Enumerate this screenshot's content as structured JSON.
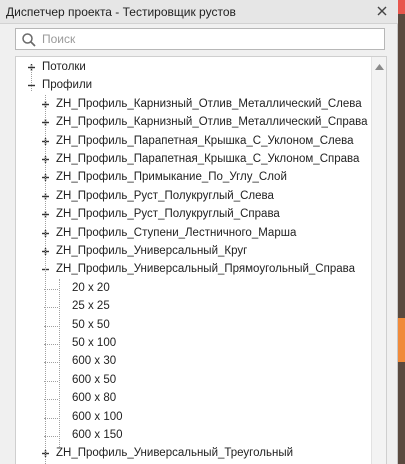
{
  "panel": {
    "title": "Диспетчер проекта - Тестировщик рустов"
  },
  "search": {
    "placeholder": "Поиск",
    "value": ""
  },
  "tree": [
    {
      "label": "Потолки",
      "level": 0,
      "state": "collapsed"
    },
    {
      "label": "Профили",
      "level": 0,
      "state": "expanded"
    },
    {
      "label": "ZH_Профиль_Карнизный_Отлив_Металлический_Слева",
      "level": 1,
      "state": "collapsed"
    },
    {
      "label": "ZH_Профиль_Карнизный_Отлив_Металлический_Справа",
      "level": 1,
      "state": "collapsed"
    },
    {
      "label": "ZH_Профиль_Парапетная_Крышка_С_Уклоном_Слева",
      "level": 1,
      "state": "collapsed"
    },
    {
      "label": "ZH_Профиль_Парапетная_Крышка_С_Уклоном_Справа",
      "level": 1,
      "state": "collapsed"
    },
    {
      "label": "ZH_Профиль_Примыкание_По_Углу_Слой",
      "level": 1,
      "state": "collapsed"
    },
    {
      "label": "ZH_Профиль_Руст_Полукруглый_Слева",
      "level": 1,
      "state": "collapsed"
    },
    {
      "label": "ZH_Профиль_Руст_Полукруглый_Справа",
      "level": 1,
      "state": "collapsed"
    },
    {
      "label": "ZH_Профиль_Ступени_Лестничного_Марша",
      "level": 1,
      "state": "collapsed"
    },
    {
      "label": "ZH_Профиль_Универсальный_Круг",
      "level": 1,
      "state": "collapsed"
    },
    {
      "label": "ZH_Профиль_Универсальный_Прямоугольный_Справа",
      "level": 1,
      "state": "expanded"
    },
    {
      "label": "20 x 20",
      "level": 2,
      "state": "leaf"
    },
    {
      "label": "25 x 25",
      "level": 2,
      "state": "leaf"
    },
    {
      "label": "50 x 50",
      "level": 2,
      "state": "leaf"
    },
    {
      "label": "50 x 100",
      "level": 2,
      "state": "leaf"
    },
    {
      "label": "600 x 30",
      "level": 2,
      "state": "leaf"
    },
    {
      "label": "600 x 50",
      "level": 2,
      "state": "leaf"
    },
    {
      "label": "600 x 80",
      "level": 2,
      "state": "leaf"
    },
    {
      "label": "600 x 100",
      "level": 2,
      "state": "leaf"
    },
    {
      "label": "600 x 150",
      "level": 2,
      "state": "leaf"
    },
    {
      "label": "ZH_Профиль_Универсальный_Треугольный",
      "level": 1,
      "state": "collapsed"
    }
  ],
  "colors": {
    "panel_bg": "#f0f0f0",
    "tree_bg": "#ffffff",
    "text": "#222222",
    "accent_red": "#e8564d",
    "accent_orange": "#f08a3a"
  }
}
